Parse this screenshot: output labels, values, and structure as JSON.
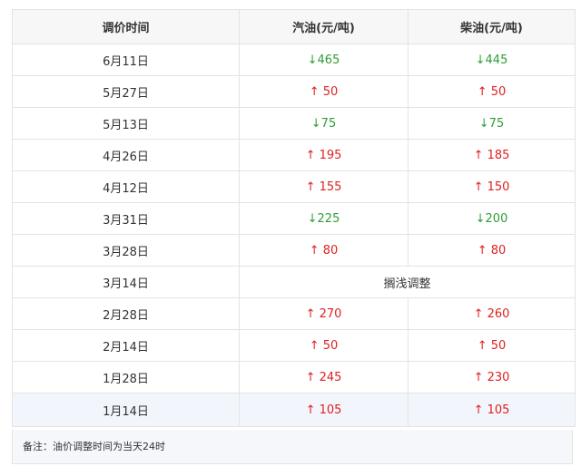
{
  "table": {
    "headers": [
      "调价时间",
      "汽油(元/吨)",
      "柴油(元/吨)"
    ],
    "rows": [
      {
        "date": "6月11日",
        "gasoline": "↓465",
        "diesel": "↓445",
        "gasoline_dir": "down",
        "diesel_dir": "down"
      },
      {
        "date": "5月27日",
        "gasoline": "↑ 50",
        "diesel": "↑ 50",
        "gasoline_dir": "up",
        "diesel_dir": "up"
      },
      {
        "date": "5月13日",
        "gasoline": "↓75",
        "diesel": "↓75",
        "gasoline_dir": "down",
        "diesel_dir": "down"
      },
      {
        "date": "4月26日",
        "gasoline": "↑ 195",
        "diesel": "↑ 185",
        "gasoline_dir": "up",
        "diesel_dir": "up"
      },
      {
        "date": "4月12日",
        "gasoline": "↑ 155",
        "diesel": "↑ 150",
        "gasoline_dir": "up",
        "diesel_dir": "up"
      },
      {
        "date": "3月31日",
        "gasoline": "↓225",
        "diesel": "↓200",
        "gasoline_dir": "down",
        "diesel_dir": "down"
      },
      {
        "date": "3月28日",
        "gasoline": "↑ 80",
        "diesel": "↑ 80",
        "gasoline_dir": "up",
        "diesel_dir": "up"
      },
      {
        "date": "3月14日",
        "merged": "搁浅调整"
      },
      {
        "date": "2月28日",
        "gasoline": "↑ 270",
        "diesel": "↑ 260",
        "gasoline_dir": "up",
        "diesel_dir": "up"
      },
      {
        "date": "2月14日",
        "gasoline": "↑ 50",
        "diesel": "↑ 50",
        "gasoline_dir": "up",
        "diesel_dir": "up"
      },
      {
        "date": "1月28日",
        "gasoline": "↑ 245",
        "diesel": "↑ 230",
        "gasoline_dir": "up",
        "diesel_dir": "up"
      },
      {
        "date": "1月14日",
        "gasoline": "↑ 105",
        "diesel": "↑ 105",
        "gasoline_dir": "up",
        "diesel_dir": "up"
      }
    ]
  },
  "note": "备注：油价调整时间为当天24时",
  "colors": {
    "up": "#e02020",
    "down": "#2e9e35",
    "border": "#e3e3e3",
    "header_bg": "#f7f7f7"
  }
}
